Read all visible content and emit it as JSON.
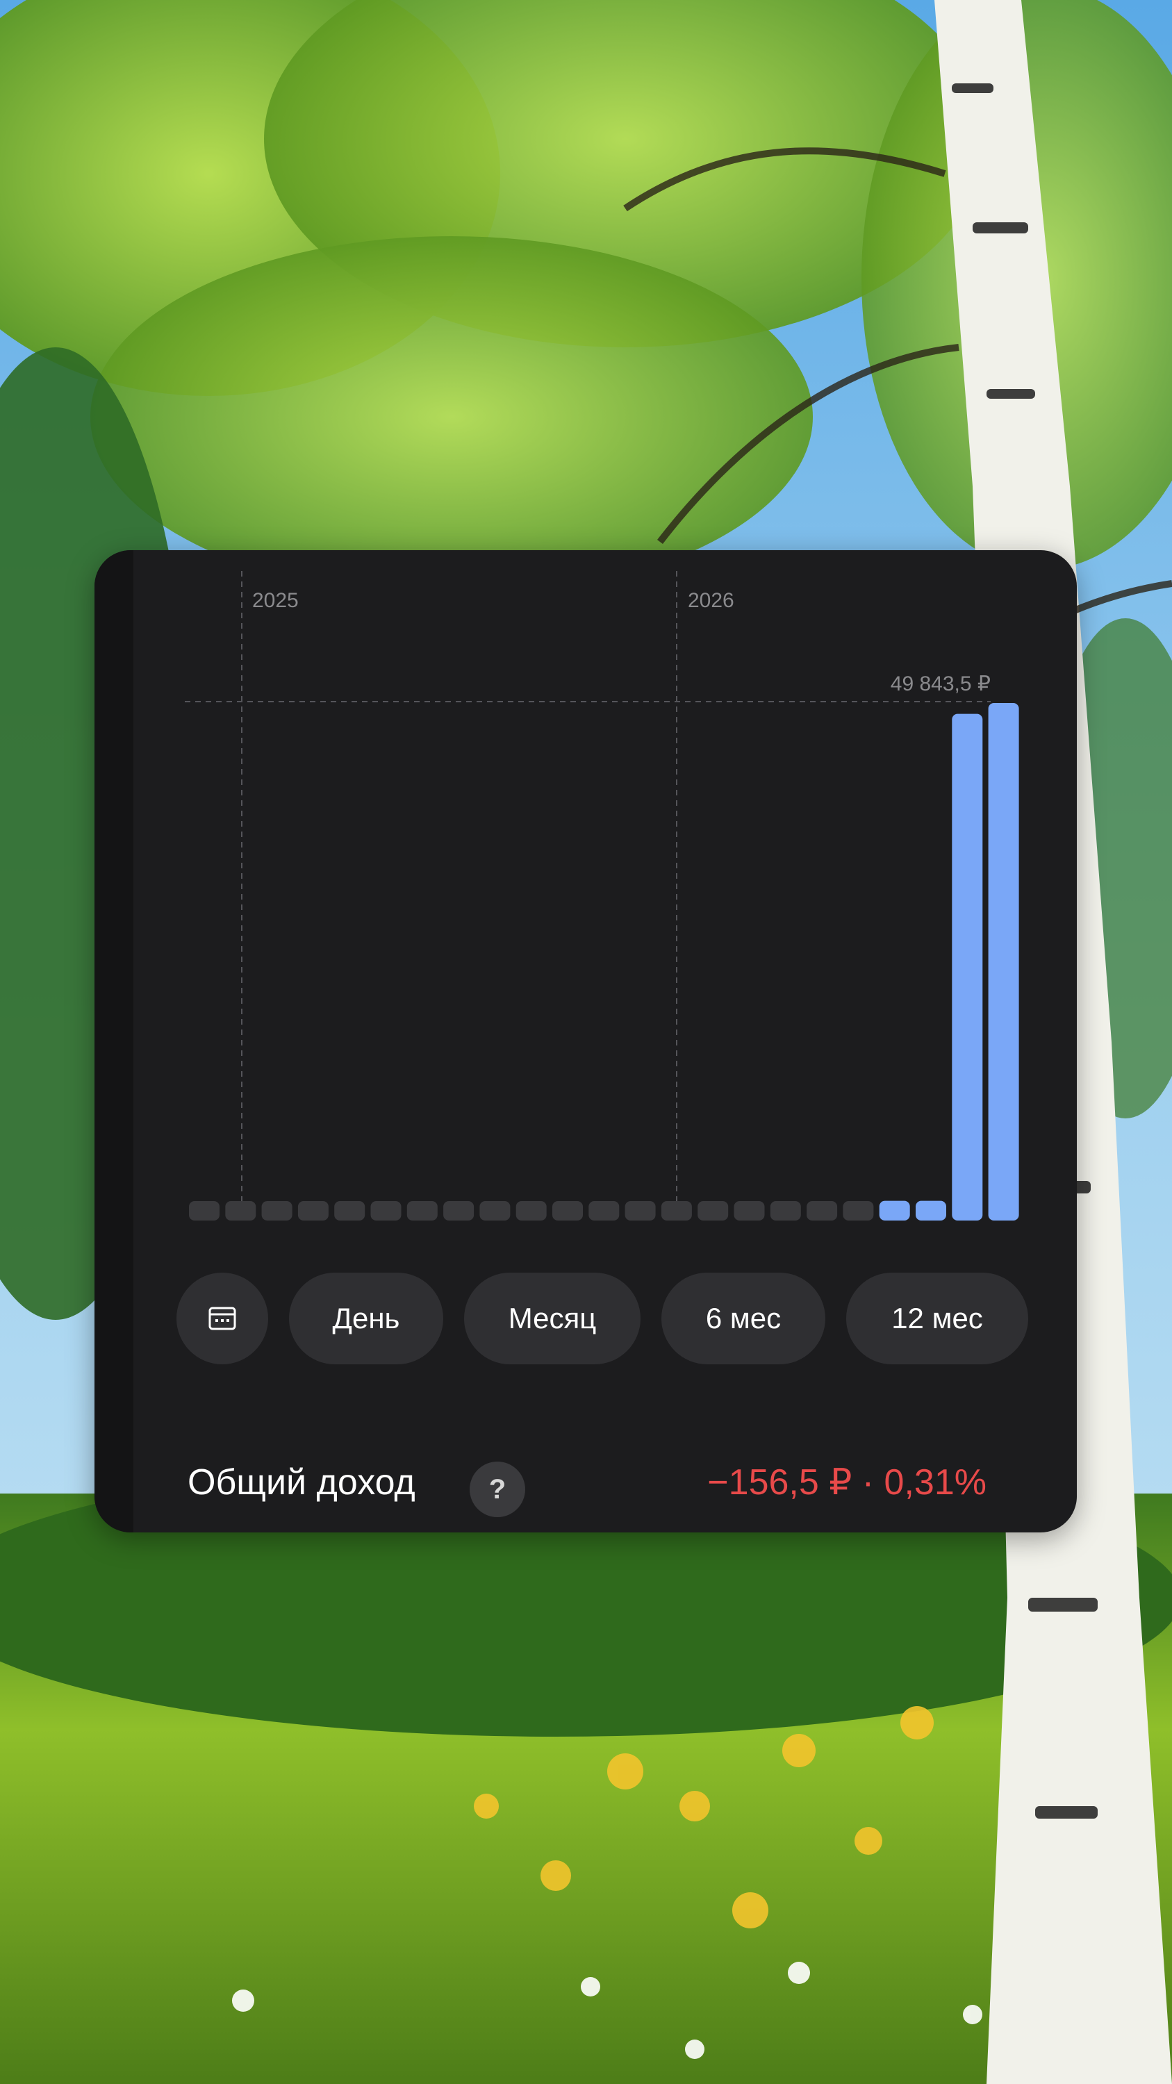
{
  "widget": {
    "period_buttons": [
      "День",
      "Месяц",
      "6 мес",
      "12 мес"
    ],
    "calendar_icon": "calendar-icon",
    "footer": {
      "label": "Общий доход",
      "help_symbol": "?",
      "income_value": "−156,5 ₽",
      "separator": "·",
      "income_percent": "0,31%",
      "income_color": "#e84a4a"
    }
  },
  "colors": {
    "bar_active": "#7aa7f7",
    "bar_inactive": "#3a3a3d",
    "widget_bg": "#1c1c1e"
  },
  "chart_data": {
    "type": "bar",
    "year_markers": [
      "2025",
      "2026"
    ],
    "max_label": "49 843,5 ₽",
    "max_value": 49843.5,
    "ylim": [
      0,
      49843.5
    ],
    "values": [
      0,
      0,
      0,
      0,
      0,
      0,
      0,
      0,
      0,
      0,
      0,
      0,
      0,
      0,
      0,
      0,
      0,
      0,
      0,
      1900,
      1900,
      48800,
      49843.5
    ],
    "active": [
      false,
      false,
      false,
      false,
      false,
      false,
      false,
      false,
      false,
      false,
      false,
      false,
      false,
      false,
      false,
      false,
      false,
      false,
      false,
      true,
      true,
      true,
      true
    ],
    "grid": false
  }
}
